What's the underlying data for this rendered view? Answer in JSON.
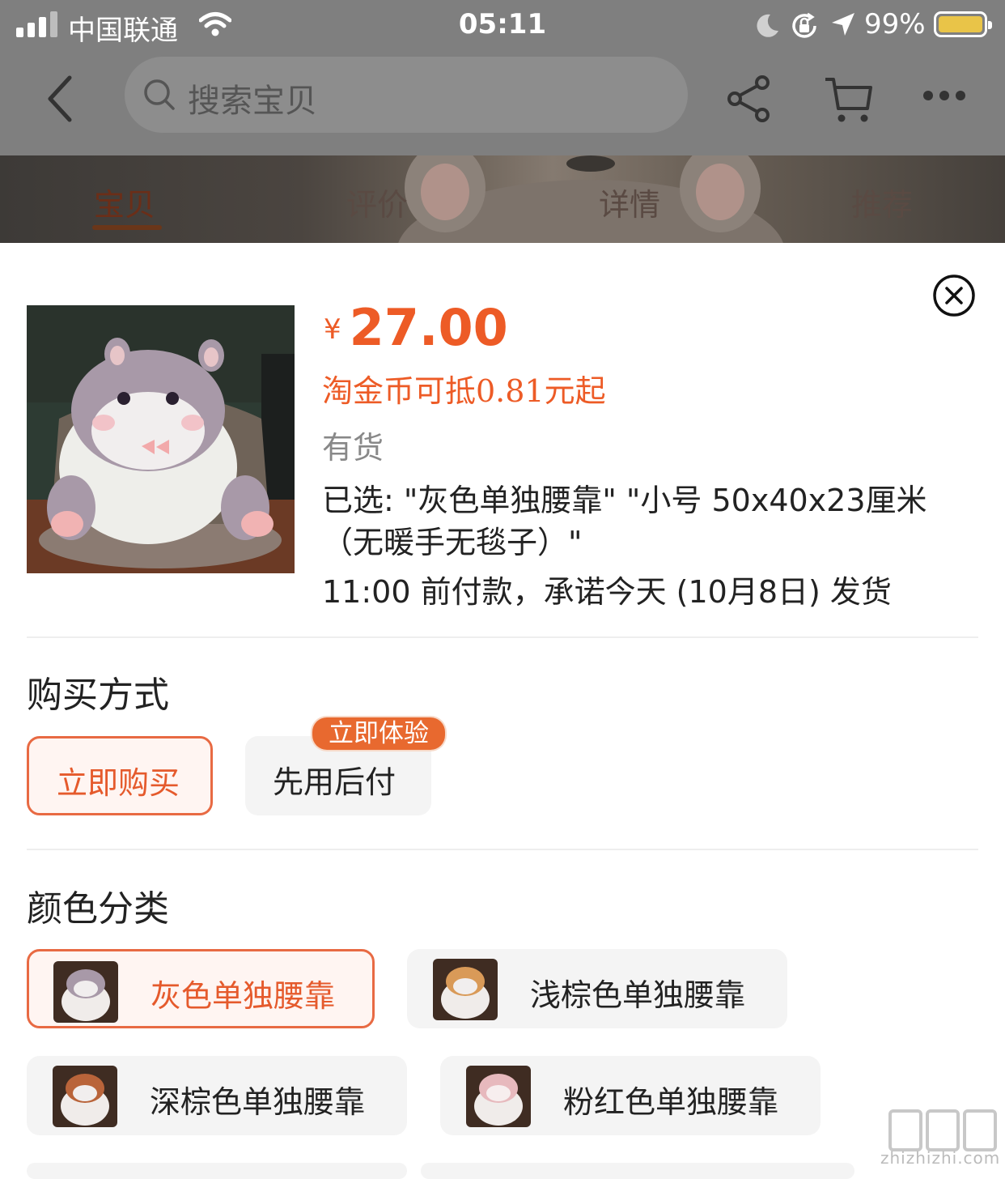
{
  "status_bar": {
    "carrier": "中国联通",
    "time": "05:11",
    "battery_percent": "99%",
    "icons": [
      "signal-icon",
      "wifi-icon",
      "moon-icon",
      "rotation-lock-icon",
      "location-icon",
      "battery-icon"
    ]
  },
  "nav": {
    "search_placeholder": "搜索宝贝",
    "icons": [
      "back-icon",
      "search-icon",
      "share-icon",
      "cart-icon",
      "more-icon"
    ]
  },
  "bg_tabs": [
    {
      "label": "宝贝",
      "active": true
    },
    {
      "label": "评价",
      "active": false
    },
    {
      "label": "详情",
      "active": false
    },
    {
      "label": "推荐",
      "active": false
    }
  ],
  "sku": {
    "currency": "¥",
    "price": "27.00",
    "coin_note": "淘金币可抵0.81元起",
    "stock": "有货",
    "selected": "已选: \"灰色单独腰靠\" \"小号 50x40x23厘米（无暖手无毯子）\"",
    "shipping": "11:00 前付款，承诺今天 (10月8日) 发货"
  },
  "purchase": {
    "title": "购买方式",
    "options": [
      {
        "label": "立即购买",
        "selected": true
      },
      {
        "label": "先用后付",
        "selected": false
      }
    ],
    "badge": "立即体验"
  },
  "color": {
    "title": "颜色分类",
    "options": [
      {
        "label": "灰色单独腰靠",
        "selected": true,
        "tint": "#a99aaa"
      },
      {
        "label": "浅棕色单独腰靠",
        "selected": false,
        "tint": "#d99a58"
      },
      {
        "label": "深棕色单独腰靠",
        "selected": false,
        "tint": "#b9643a"
      },
      {
        "label": "粉红色单独腰靠",
        "selected": false,
        "tint": "#e7b9bd"
      }
    ]
  },
  "colors": {
    "accent": "#ED5B26",
    "selected_border": "#E86A43",
    "badge_bg": "#E8692F"
  },
  "watermark": {
    "site": "zhizhizhi.com"
  }
}
